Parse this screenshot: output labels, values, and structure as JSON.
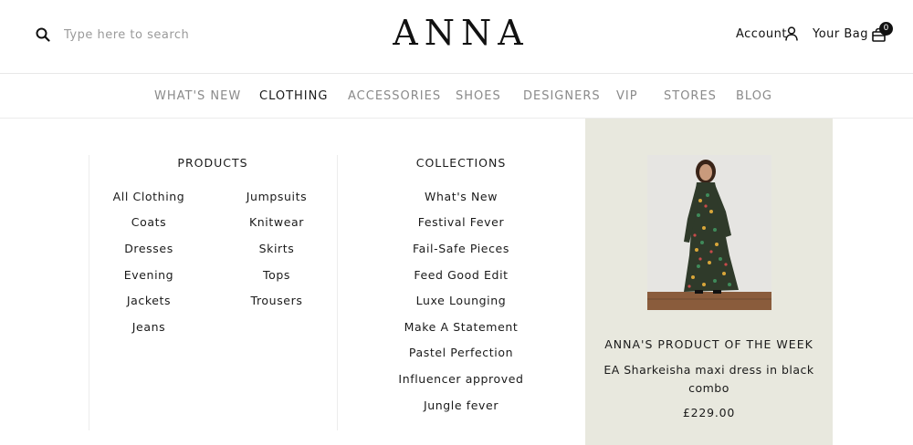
{
  "header": {
    "search_placeholder": "Type here to search",
    "logo": "ANNA",
    "account_label": "Account",
    "bag_label": "Your Bag",
    "bag_count": "0"
  },
  "nav": {
    "items": [
      {
        "label": "WHAT'S NEW",
        "active": false
      },
      {
        "label": "CLOTHING",
        "active": true
      },
      {
        "label": "ACCESSORIES",
        "active": false
      },
      {
        "label": "SHOES",
        "active": false
      },
      {
        "label": "DESIGNERS",
        "active": false
      },
      {
        "label": "VIP",
        "active": false
      },
      {
        "label": "STORES",
        "active": false
      },
      {
        "label": "BLOG",
        "active": false
      }
    ]
  },
  "mega_menu": {
    "products": {
      "heading": "PRODUCTS",
      "left": [
        "All Clothing",
        "Coats",
        "Dresses",
        "Evening",
        "Jackets",
        "Jeans"
      ],
      "right": [
        "Jumpsuits",
        "Knitwear",
        "Skirts",
        "Tops",
        "Trousers"
      ]
    },
    "collections": {
      "heading": "COLLECTIONS",
      "items": [
        "What's New",
        "Festival Fever",
        "Fail-Safe Pieces",
        "Feed Good Edit",
        "Luxe Lounging",
        "Make A Statement",
        "Pastel Perfection",
        "Influencer approved",
        "Jungle fever"
      ]
    },
    "promo": {
      "title": "ANNA'S PRODUCT OF THE WEEK",
      "product_name": "EA Sharkeisha maxi dress in black combo",
      "price": "£229.00"
    }
  },
  "colors": {
    "text": "#1a1a1a",
    "muted_nav": "#8a8a8a",
    "placeholder": "#9a9a9a",
    "promo_bg": "#e8e8de"
  }
}
